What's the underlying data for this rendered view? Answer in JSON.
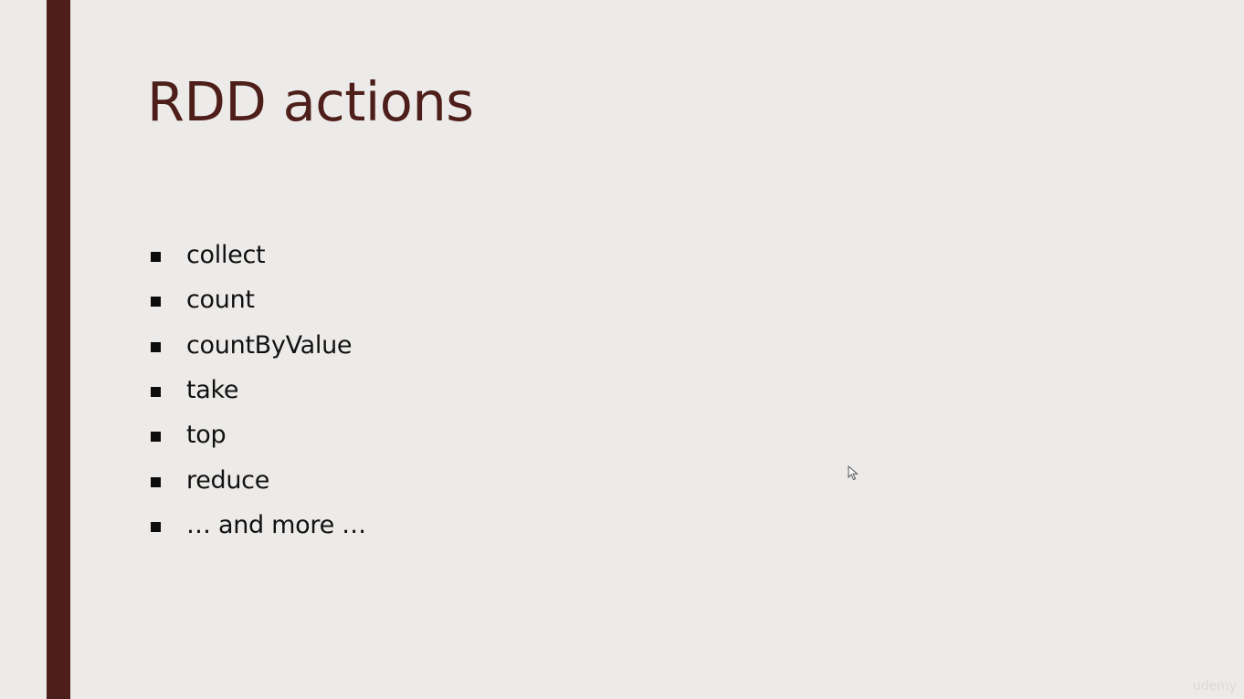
{
  "slide": {
    "title": "RDD actions",
    "bullets": [
      {
        "label": "collect"
      },
      {
        "label": "count"
      },
      {
        "label": "countByValue"
      },
      {
        "label": "take"
      },
      {
        "label": "top"
      },
      {
        "label": "reduce"
      },
      {
        "label": "… and more …"
      }
    ],
    "watermark": "udemy"
  },
  "colors": {
    "background": "#edebe9",
    "accent": "#4e1f1a",
    "text": "#111111"
  },
  "icons": {
    "bullet": "square-bullet-icon",
    "pointer": "mouse-pointer-icon"
  }
}
